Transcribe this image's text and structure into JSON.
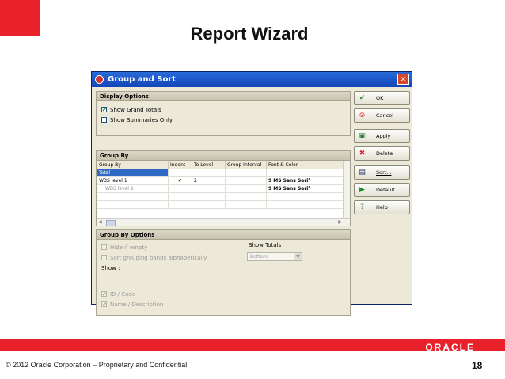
{
  "slide": {
    "title": "Report Wizard",
    "copyright": "© 2012 Oracle Corporation – Proprietary and Confidential",
    "page_number": "18",
    "logo_text": "ORACLE",
    "brand_color": "#e8212b"
  },
  "dialog": {
    "title": "Group and Sort",
    "close_label": "×",
    "display_options": {
      "header": "Display Options",
      "show_grand_totals": {
        "label": "Show Grand Totals",
        "checked": true
      },
      "show_summaries_only": {
        "label": "Show Summaries Only",
        "checked": false
      }
    },
    "group_by": {
      "header": "Group By",
      "columns": [
        "Group By",
        "Indent",
        "To Level",
        "Group Interval",
        "Font & Color"
      ],
      "rows": [
        {
          "group_by": "Total",
          "indent": "",
          "to_level": "",
          "group_interval": "",
          "font": ""
        },
        {
          "group_by": "WBS level 1",
          "indent": "✔",
          "to_level": "2",
          "group_interval": "",
          "font": "9 MS Sans Serif"
        },
        {
          "group_by": "WBS level 2",
          "indent": "",
          "to_level": "",
          "group_interval": "",
          "font": "9 MS Sans Serif"
        }
      ]
    },
    "group_by_options": {
      "header": "Group By Options",
      "hide_if_empty": "Hide if empty",
      "sort_alpha": "Sort grouping bands alphabetically",
      "show_label": "Show :",
      "id_code": "ID / Code",
      "name_description": "Name / Description",
      "show_totals_label": "Show Totals",
      "show_totals_value": "Bottom"
    },
    "buttons": {
      "ok": "OK",
      "cancel": "Cancel",
      "apply": "Apply",
      "delete": "Delete",
      "sort": "Sort...",
      "default": "Default",
      "help": "Help"
    }
  }
}
